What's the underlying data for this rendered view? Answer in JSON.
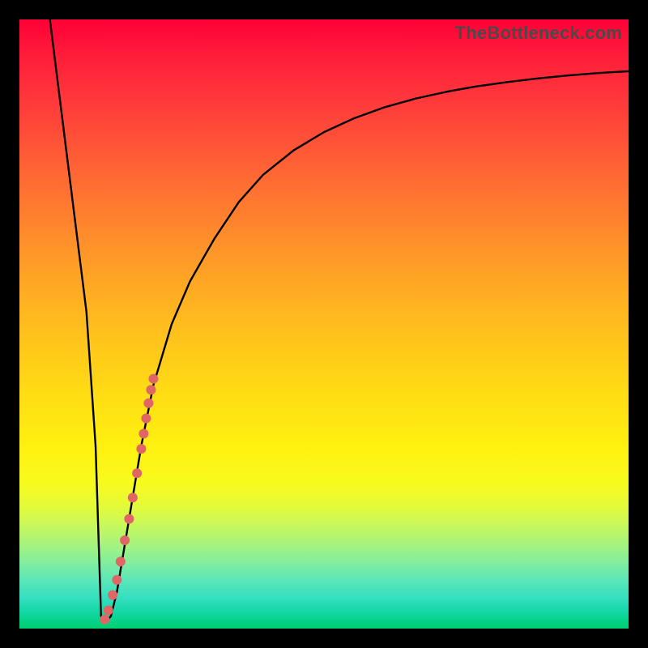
{
  "watermark": "TheBottleneck.com",
  "colors": {
    "frame": "#000000",
    "curve_stroke": "#000000",
    "dot_fill": "#e06666",
    "gradient_top": "#ff0037",
    "gradient_bottom": "#00d070"
  },
  "chart_data": {
    "type": "line",
    "title": "",
    "xlabel": "",
    "ylabel": "",
    "xlim": [
      0,
      100
    ],
    "ylim": [
      0,
      100
    ],
    "grid": false,
    "legend": false,
    "series": [
      {
        "name": "curve",
        "x": [
          5,
          7,
          9,
          11,
          12.5,
          13.4,
          14,
          15,
          16,
          18,
          20,
          22,
          25,
          28,
          32,
          36,
          40,
          45,
          50,
          55,
          60,
          65,
          70,
          75,
          80,
          85,
          90,
          95,
          100
        ],
        "y": [
          100,
          84,
          68,
          52,
          30,
          2,
          1,
          2,
          6,
          18,
          30,
          40,
          50,
          57,
          64,
          70,
          74.5,
          78.5,
          81.5,
          83.8,
          85.6,
          87,
          88.1,
          89,
          89.7,
          90.3,
          90.8,
          91.2,
          91.5
        ]
      }
    ],
    "dots": {
      "name": "highlight",
      "x": [
        14.0,
        14.6,
        15.3,
        16.0,
        16.6,
        17.3,
        18.0,
        18.6,
        19.3,
        20.0,
        20.4,
        20.8,
        21.2,
        21.6,
        22.0
      ],
      "y": [
        1.5,
        3.0,
        5.5,
        8.0,
        11.0,
        14.5,
        18.0,
        21.5,
        25.5,
        29.5,
        32.0,
        34.5,
        37.0,
        39.2,
        41.0
      ],
      "radius": 6
    }
  }
}
